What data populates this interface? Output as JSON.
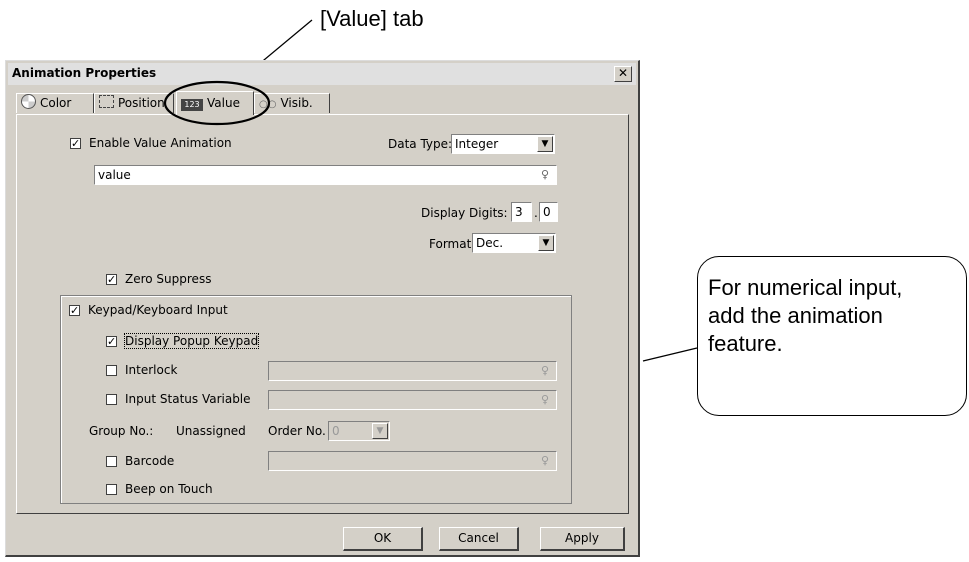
{
  "annotations": {
    "tab_label": "[Value] tab",
    "callout_text_lines": [
      "For numerical input,",
      "add the animation",
      "feature."
    ]
  },
  "dialog": {
    "title": "Animation Properties",
    "close_symbol": "✕",
    "tabs": [
      {
        "label": "Color",
        "icon": "color-wheel-icon"
      },
      {
        "label": "Position",
        "icon": "position-icon"
      },
      {
        "label": "Value",
        "icon": "value-123-icon",
        "active": true
      },
      {
        "label": "Visib.",
        "icon": "visibility-icon"
      }
    ],
    "value_tab": {
      "enable_value_animation": {
        "label": "Enable Value Animation",
        "checked": true
      },
      "data_type": {
        "label": "Data Type:",
        "value": "Integer"
      },
      "expression": {
        "value": "value"
      },
      "display_digits": {
        "label": "Display Digits:",
        "integer": "3",
        "separator": ".",
        "decimal": "0"
      },
      "format": {
        "label": "Format:",
        "value": "Dec."
      },
      "zero_suppress": {
        "label": "Zero Suppress",
        "checked": true
      },
      "keypad": {
        "label": "Keypad/Keyboard Input",
        "checked": true,
        "display_popup_keypad": {
          "label": "Display Popup Keypad",
          "checked": true
        },
        "interlock": {
          "label": "Interlock",
          "checked": false
        },
        "input_status_variable": {
          "label": "Input Status Variable",
          "checked": false
        },
        "group_no": {
          "label": "Group No.:",
          "value": "Unassigned"
        },
        "order_no": {
          "label": "Order No.",
          "value": "0"
        },
        "barcode": {
          "label": "Barcode",
          "checked": false
        },
        "beep_on_touch": {
          "label": "Beep on Touch",
          "checked": false
        }
      }
    },
    "buttons": {
      "ok": "OK",
      "cancel": "Cancel",
      "apply": "Apply"
    }
  }
}
